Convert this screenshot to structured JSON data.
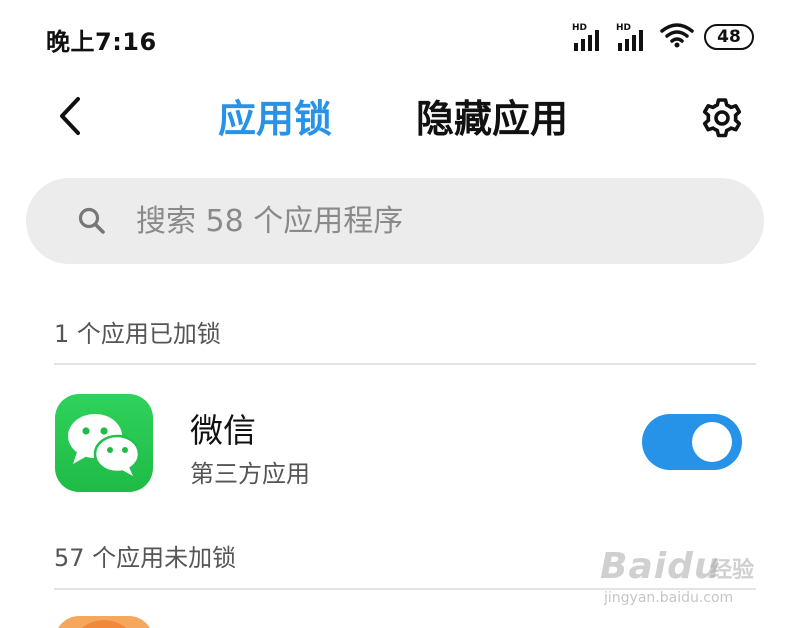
{
  "status_bar": {
    "time": "晚上7:16",
    "signal_label": "HD",
    "battery": "48",
    "icons": [
      "signal-icon",
      "signal-icon",
      "wifi-icon",
      "battery-icon"
    ]
  },
  "header": {
    "back_icon": "chevron-left-icon",
    "tabs": [
      {
        "label": "应用锁",
        "active": true
      },
      {
        "label": "隐藏应用",
        "active": false
      }
    ],
    "settings_icon": "gear-icon"
  },
  "search": {
    "placeholder": "搜索 58 个应用程序",
    "icon": "search-icon"
  },
  "sections": [
    {
      "title": "1 个应用已加锁",
      "apps": [
        {
          "name": "微信",
          "subtitle": "第三方应用",
          "locked": true,
          "icon": "wechat-icon"
        }
      ]
    },
    {
      "title": "57 个应用未加锁"
    }
  ],
  "watermark": {
    "logo": "Baidu",
    "cn": "经验",
    "url": "jingyan.baidu.com"
  },
  "colors": {
    "accent": "#2793e8",
    "wechat_green": "#1fbb47",
    "search_bg": "#ececec"
  }
}
